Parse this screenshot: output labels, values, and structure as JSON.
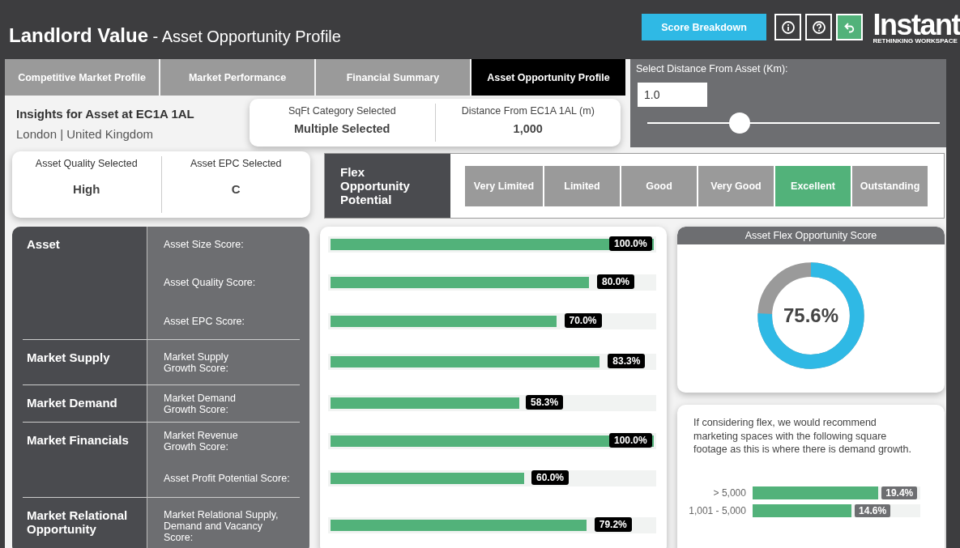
{
  "header": {
    "title": "**Landlord Value** - Asset Opportunity Profile",
    "buttons": [
      {
        "kind": "text",
        "label": "Score Breakdown"
      },
      {
        "kind": "info"
      },
      {
        "kind": "help"
      },
      {
        "kind": "reset"
      }
    ],
    "logo": {
      "name": "Instant",
      "tagline": "RETHINKING WORKSPACE"
    }
  },
  "tabs": [
    {
      "label": "Competitive Market Profile",
      "selected": false
    },
    {
      "label": "Market Performance",
      "selected": false
    },
    {
      "label": "Financial Summary",
      "selected": false
    },
    {
      "label": "Asset Opportunity Profile",
      "selected": true
    }
  ],
  "asset": {
    "title": "Insights for Asset at EC1A 1AL",
    "location": "London | United Kingdom"
  },
  "selections": [
    {
      "label": "SqFt Category Selected",
      "value": "Multiple Selected"
    },
    {
      "label": "Distance From EC1A 1AL (m)",
      "value": "1,000"
    }
  ],
  "distance": {
    "label": "Select Distance From Asset (Km):",
    "value": "1.0",
    "level": 0.315
  },
  "quality": [
    {
      "label": "Asset Quality Selected",
      "value": "High"
    },
    {
      "label": "Asset EPC Selected",
      "value": "C"
    }
  ],
  "flex_potential": {
    "title": "Flex Opportunity Potential",
    "options": [
      {
        "label": "Very Limited",
        "selected": false
      },
      {
        "label": "Limited",
        "selected": false
      },
      {
        "label": "Good",
        "selected": false
      },
      {
        "label": "Very Good",
        "selected": false
      },
      {
        "label": "Excellent",
        "selected": true
      },
      {
        "label": "Outstanding",
        "selected": false
      }
    ]
  },
  "score_groups": [
    {
      "name": "Asset",
      "scores": [
        {
          "label": "Asset Size Score:",
          "level": 1.0,
          "reading": "100.0%"
        },
        {
          "label": "Asset Quality Score:",
          "level": 0.8,
          "reading": "80.0%"
        },
        {
          "label": "Asset EPC Score:",
          "level": 0.7,
          "reading": "70.0%"
        }
      ]
    },
    {
      "name": "Market Supply",
      "scores": [
        {
          "label": "Market Supply\nGrowth Score:",
          "level": 0.833,
          "reading": "83.3%"
        }
      ]
    },
    {
      "name": "Market Demand",
      "scores": [
        {
          "label": "Market Demand\nGrowth Score:",
          "level": 0.583,
          "reading": "58.3%"
        }
      ]
    },
    {
      "name": "Market Financials",
      "scores": [
        {
          "label": "Market Revenue\nGrowth Score:",
          "level": 1.0,
          "reading": "100.0%"
        },
        {
          "label": "Asset Profit Potential Score:",
          "level": 0.6,
          "reading": "60.0%"
        }
      ]
    },
    {
      "name": "Market Relational Opportunity",
      "scores": [
        {
          "label": "Market Relational Supply,\nDemand and Vacancy\nScore:",
          "level": 0.792,
          "reading": "79.2%"
        }
      ]
    }
  ],
  "flex_score": {
    "title": "Asset Flex Opportunity Score",
    "level": 0.756,
    "reading": "75.6%"
  },
  "recommendation": {
    "text": "If considering flex, we would recommend marketing spaces with the following square footage as this is where there is demand growth.",
    "bars": [
      {
        "label": "> 5,000",
        "level": 0.75,
        "reading": "19.4%"
      },
      {
        "label": "1,001 - 5,000",
        "level": 0.59,
        "reading": "14.6%"
      }
    ]
  }
}
